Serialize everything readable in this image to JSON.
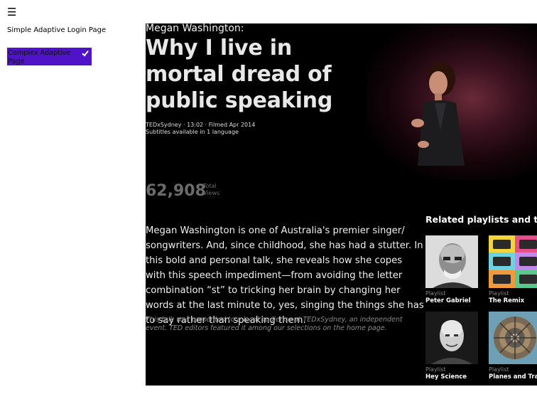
{
  "nav": {
    "menu_icon": "hamburger-icon",
    "items": [
      {
        "label": "Simple Adaptive Login Page",
        "selected": false
      },
      {
        "label": "Complex Adaptive Page",
        "selected": true,
        "check_icon": "checkmark-icon"
      }
    ],
    "selected_color": "#4f14c7"
  },
  "talk": {
    "speaker": "Megan Washington:",
    "title": "Why I live in mortal dread of public speaking",
    "meta_line1": "TEDxSydney · 13:02 · Filmed Apr 2014",
    "meta_line2": "Subtitles available in 1 language",
    "views_count": "62,908",
    "views_label_1": "Total",
    "views_label_2": "Views",
    "description": "Megan Washington is one of Australia's premier singer/ songwriters. And, since childhood, she has had a stutter. In this bold and personal talk, she reveals how she copes with this speech impediment—from avoiding the letter combination “st” to tricking her brain by changing her words at the last minute to, yes, singing the things she has to say rather than speaking them.",
    "note": "This talk was presented to a local audience at TEDxSydney, an independent event. TED editors featured it among our selections on the home page."
  },
  "related": {
    "heading": "Related playlists and talks",
    "items": [
      {
        "kind": "Playlist",
        "name": "Peter Gabriel"
      },
      {
        "kind": "Playlist",
        "name": "The Remix"
      },
      {
        "kind": "Playlist",
        "name": "Hey Science"
      },
      {
        "kind": "Playlist",
        "name": "Planes and Trains"
      }
    ]
  },
  "colors": {
    "panel_bg": "#000000",
    "muted_text": "#6b6b6b"
  }
}
